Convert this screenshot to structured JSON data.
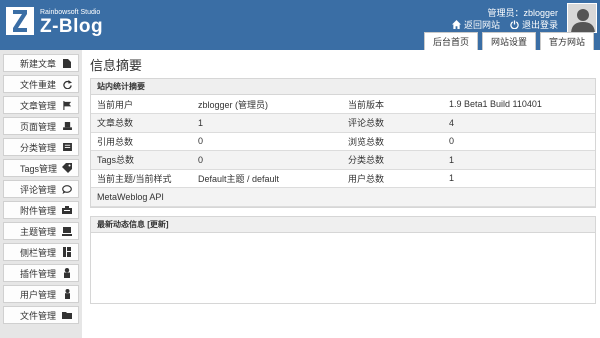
{
  "header": {
    "studio": "Rainbowsoft Studio",
    "brand": "Z-Blog",
    "admin_label": "管理员：zblogger",
    "home_link": "返回网站",
    "logout_link": "退出登录",
    "tabs": [
      "后台首页",
      "网站设置",
      "官方网站"
    ]
  },
  "sidebar": {
    "items": [
      {
        "label": "新建文章",
        "icon": "new-doc-icon"
      },
      {
        "label": "文件重建",
        "icon": "rebuild-icon"
      },
      {
        "label": "文章管理",
        "icon": "flag-icon"
      },
      {
        "label": "页面管理",
        "icon": "page-icon"
      },
      {
        "label": "分类管理",
        "icon": "folder-icon"
      },
      {
        "label": "Tags管理",
        "icon": "tag-icon"
      },
      {
        "label": "评论管理",
        "icon": "comment-icon"
      },
      {
        "label": "附件管理",
        "icon": "attachment-icon"
      },
      {
        "label": "主题管理",
        "icon": "monitor-icon"
      },
      {
        "label": "侧栏管理",
        "icon": "sidebar-icon"
      },
      {
        "label": "插件管理",
        "icon": "plugin-icon"
      },
      {
        "label": "用户管理",
        "icon": "user-icon"
      },
      {
        "label": "文件管理",
        "icon": "files-icon"
      }
    ]
  },
  "main": {
    "title": "信息摘要",
    "stats_heading": "站内统计摘要",
    "stats": [
      [
        "当前用户",
        "zblogger (管理员)",
        "当前版本",
        "1.9 Beta1 Build 110401"
      ],
      [
        "文章总数",
        "1",
        "评论总数",
        "4"
      ],
      [
        "引用总数",
        "0",
        "浏览总数",
        "0"
      ],
      [
        "Tags总数",
        "0",
        "分类总数",
        "1"
      ],
      [
        "当前主题/当前样式",
        "Default主题 / default",
        "用户总数",
        "1"
      ],
      [
        "MetaWeblog API",
        "",
        "",
        ""
      ]
    ],
    "recent_heading": "最新动态信息 [更新]"
  },
  "colors": {
    "header_bg": "#3a6ea5",
    "sidebar_bg": "#e6e6e6"
  }
}
